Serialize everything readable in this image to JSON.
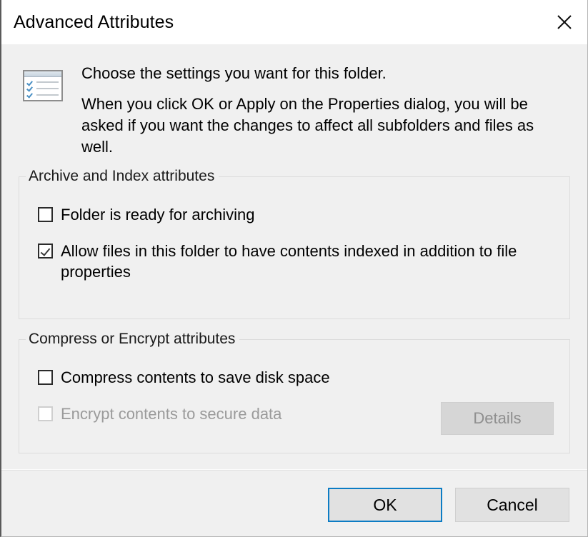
{
  "window": {
    "title": "Advanced Attributes",
    "close_icon": "close-x-icon"
  },
  "intro": {
    "icon": "checklist-window-icon",
    "line1": "Choose the settings you want for this folder.",
    "paragraph": "When you click OK or Apply on the Properties dialog, you will be asked if you want the changes to affect all subfolders and files as well."
  },
  "groups": {
    "archive": {
      "label": "Archive and Index attributes",
      "options": [
        {
          "label": "Folder is ready for archiving",
          "checked": false,
          "enabled": true
        },
        {
          "label": "Allow files in this folder to have contents indexed in addition to file properties",
          "checked": true,
          "enabled": true
        }
      ]
    },
    "compress": {
      "label": "Compress or Encrypt attributes",
      "options": [
        {
          "label": "Compress contents to save disk space",
          "checked": false,
          "enabled": true
        },
        {
          "label": "Encrypt contents to secure data",
          "checked": false,
          "enabled": false
        }
      ],
      "details_button": "Details"
    }
  },
  "footer": {
    "ok_label": "OK",
    "cancel_label": "Cancel"
  },
  "colors": {
    "accent": "#0c7cc4",
    "dialog_bg": "#f0f0f0",
    "titlebar_bg": "#ffffff",
    "disabled_text": "#9a9a9a",
    "button_bg": "#e1e1e1"
  }
}
